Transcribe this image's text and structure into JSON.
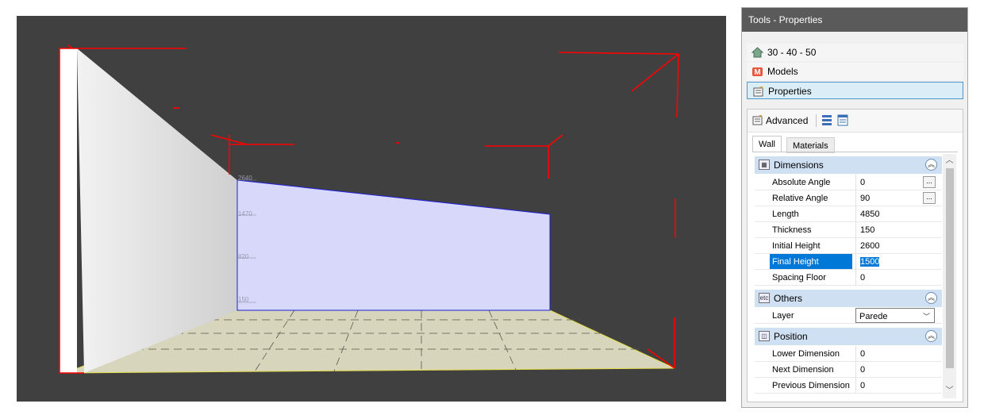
{
  "viewport": {
    "dimension_labels": [
      "2640",
      "1470",
      "820",
      "150"
    ]
  },
  "panel": {
    "title": "Tools - Properties",
    "nav": [
      {
        "label": "30 - 40 - 50",
        "icon": "house-icon"
      },
      {
        "label": "Models",
        "icon": "models-icon"
      },
      {
        "label": "Properties",
        "icon": "properties-icon",
        "selected": true
      }
    ],
    "toolbar": {
      "advanced_label": "Advanced"
    },
    "tabs": [
      {
        "label": "Wall",
        "active": true
      },
      {
        "label": "Materials",
        "active": false
      }
    ],
    "sections": {
      "dimensions": {
        "title": "Dimensions",
        "rows": [
          {
            "name": "Absolute Angle",
            "value": "0"
          },
          {
            "name": "Relative Angle",
            "value": "90"
          },
          {
            "name": "Length",
            "value": "4850"
          },
          {
            "name": "Thickness",
            "value": "150"
          },
          {
            "name": "Initial Height",
            "value": "2600"
          },
          {
            "name": "Final Height",
            "value": "1500"
          },
          {
            "name": "Spacing Floor",
            "value": "0"
          }
        ]
      },
      "others": {
        "title": "Others",
        "rows": [
          {
            "name": "Layer",
            "value": "Parede"
          }
        ]
      },
      "position": {
        "title": "Position",
        "rows": [
          {
            "name": "Lower Dimension",
            "value": "0"
          },
          {
            "name": "Next Dimension",
            "value": "0"
          },
          {
            "name": "Previous Dimension",
            "value": "0"
          }
        ]
      }
    }
  },
  "colors": {
    "viewport_bg": "#404040",
    "selection": "#0078d7",
    "section_header": "#cfe0f2",
    "selected_wall": "#d8d8fb",
    "floor": "#d7d5bb",
    "guide_red": "#ff0000"
  }
}
